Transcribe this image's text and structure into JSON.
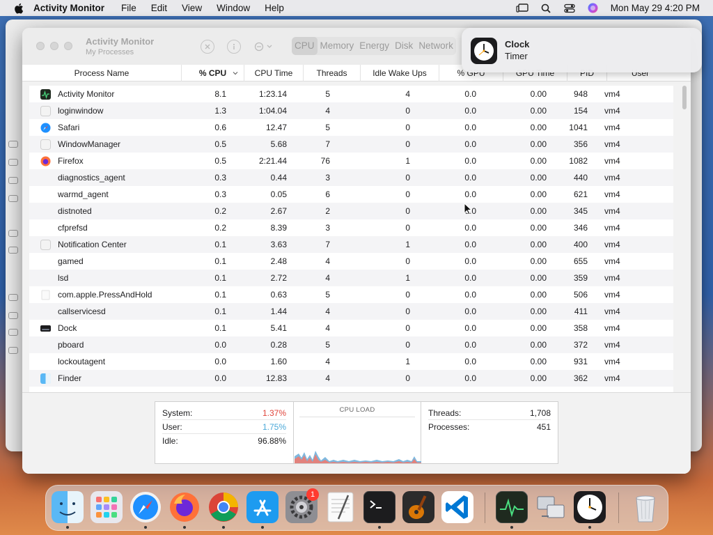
{
  "menubar": {
    "app_name": "Activity Monitor",
    "items": [
      "File",
      "Edit",
      "View",
      "Window",
      "Help"
    ],
    "datetime": "Mon May 29  4:20 PM"
  },
  "window": {
    "title": "Activity Monitor",
    "subtitle": "My Processes",
    "tabs": [
      "CPU",
      "Memory",
      "Energy",
      "Disk",
      "Network"
    ],
    "selected_tab": "CPU"
  },
  "table": {
    "columns": [
      "Process Name",
      "% CPU",
      "CPU Time",
      "Threads",
      "Idle Wake Ups",
      "% GPU",
      "GPU Time",
      "PID",
      "User"
    ],
    "sorted_column": "% CPU",
    "rows": [
      {
        "name": "Activity Monitor",
        "icon": "activity-monitor-icon",
        "cpu": "8.1",
        "cpu_time": "1:23.14",
        "threads": "5",
        "idle": "4",
        "gpu": "0.0",
        "gpu_time": "0.00",
        "pid": "948",
        "user": "vm4"
      },
      {
        "name": "loginwindow",
        "icon": "generic-app-icon",
        "cpu": "1.3",
        "cpu_time": "1:04.04",
        "threads": "4",
        "idle": "0",
        "gpu": "0.0",
        "gpu_time": "0.00",
        "pid": "154",
        "user": "vm4"
      },
      {
        "name": "Safari",
        "icon": "safari-icon",
        "cpu": "0.6",
        "cpu_time": "12.47",
        "threads": "5",
        "idle": "0",
        "gpu": "0.0",
        "gpu_time": "0.00",
        "pid": "1041",
        "user": "vm4"
      },
      {
        "name": "WindowManager",
        "icon": "generic-app-icon",
        "cpu": "0.5",
        "cpu_time": "5.68",
        "threads": "7",
        "idle": "0",
        "gpu": "0.0",
        "gpu_time": "0.00",
        "pid": "356",
        "user": "vm4"
      },
      {
        "name": "Firefox",
        "icon": "firefox-icon",
        "cpu": "0.5",
        "cpu_time": "2:21.44",
        "threads": "76",
        "idle": "1",
        "gpu": "0.0",
        "gpu_time": "0.00",
        "pid": "1082",
        "user": "vm4"
      },
      {
        "name": "diagnostics_agent",
        "icon": "",
        "cpu": "0.3",
        "cpu_time": "0.44",
        "threads": "3",
        "idle": "0",
        "gpu": "0.0",
        "gpu_time": "0.00",
        "pid": "440",
        "user": "vm4"
      },
      {
        "name": "warmd_agent",
        "icon": "",
        "cpu": "0.3",
        "cpu_time": "0.05",
        "threads": "6",
        "idle": "0",
        "gpu": "0.0",
        "gpu_time": "0.00",
        "pid": "621",
        "user": "vm4"
      },
      {
        "name": "distnoted",
        "icon": "",
        "cpu": "0.2",
        "cpu_time": "2.67",
        "threads": "2",
        "idle": "0",
        "gpu": "0.0",
        "gpu_time": "0.00",
        "pid": "345",
        "user": "vm4"
      },
      {
        "name": "cfprefsd",
        "icon": "",
        "cpu": "0.2",
        "cpu_time": "8.39",
        "threads": "3",
        "idle": "0",
        "gpu": "0.0",
        "gpu_time": "0.00",
        "pid": "346",
        "user": "vm4"
      },
      {
        "name": "Notification Center",
        "icon": "generic-app-icon",
        "cpu": "0.1",
        "cpu_time": "3.63",
        "threads": "7",
        "idle": "1",
        "gpu": "0.0",
        "gpu_time": "0.00",
        "pid": "400",
        "user": "vm4"
      },
      {
        "name": "gamed",
        "icon": "",
        "cpu": "0.1",
        "cpu_time": "2.48",
        "threads": "4",
        "idle": "0",
        "gpu": "0.0",
        "gpu_time": "0.00",
        "pid": "655",
        "user": "vm4"
      },
      {
        "name": "lsd",
        "icon": "",
        "cpu": "0.1",
        "cpu_time": "2.72",
        "threads": "4",
        "idle": "1",
        "gpu": "0.0",
        "gpu_time": "0.00",
        "pid": "359",
        "user": "vm4"
      },
      {
        "name": "com.apple.PressAndHold",
        "icon": "blank-doc-icon",
        "cpu": "0.1",
        "cpu_time": "0.63",
        "threads": "5",
        "idle": "0",
        "gpu": "0.0",
        "gpu_time": "0.00",
        "pid": "506",
        "user": "vm4"
      },
      {
        "name": "callservicesd",
        "icon": "",
        "cpu": "0.1",
        "cpu_time": "1.44",
        "threads": "4",
        "idle": "0",
        "gpu": "0.0",
        "gpu_time": "0.00",
        "pid": "411",
        "user": "vm4"
      },
      {
        "name": "Dock",
        "icon": "dock-icon",
        "cpu": "0.1",
        "cpu_time": "5.41",
        "threads": "4",
        "idle": "0",
        "gpu": "0.0",
        "gpu_time": "0.00",
        "pid": "358",
        "user": "vm4"
      },
      {
        "name": "pboard",
        "icon": "",
        "cpu": "0.0",
        "cpu_time": "0.28",
        "threads": "5",
        "idle": "0",
        "gpu": "0.0",
        "gpu_time": "0.00",
        "pid": "372",
        "user": "vm4"
      },
      {
        "name": "lockoutagent",
        "icon": "",
        "cpu": "0.0",
        "cpu_time": "1.60",
        "threads": "4",
        "idle": "1",
        "gpu": "0.0",
        "gpu_time": "0.00",
        "pid": "931",
        "user": "vm4"
      },
      {
        "name": "Finder",
        "icon": "finder-icon",
        "cpu": "0.0",
        "cpu_time": "12.83",
        "threads": "4",
        "idle": "0",
        "gpu": "0.0",
        "gpu_time": "0.00",
        "pid": "362",
        "user": "vm4"
      }
    ]
  },
  "cpu_summary": {
    "system_label": "System:",
    "system_value": "1.37%",
    "user_label": "User:",
    "user_value": "1.75%",
    "idle_label": "Idle:",
    "idle_value": "96.88%",
    "load_title": "CPU LOAD",
    "threads_label": "Threads:",
    "threads_value": "1,708",
    "processes_label": "Processes:",
    "processes_value": "451"
  },
  "notification": {
    "title": "Clock",
    "subtitle": "Timer"
  },
  "dock": {
    "apps": [
      "Finder",
      "Launchpad",
      "Safari",
      "Firefox",
      "Chrome",
      "App Store",
      "System Settings",
      "TextEdit",
      "Terminal",
      "GarageBand",
      "Visual Studio Code",
      "Activity Monitor",
      "Migration Assistant",
      "Clock",
      "Trash"
    ],
    "settings_badge": "1"
  },
  "colors": {
    "system": "#e0443a",
    "user": "#4aa8d8",
    "accent": "#0a60ff"
  }
}
